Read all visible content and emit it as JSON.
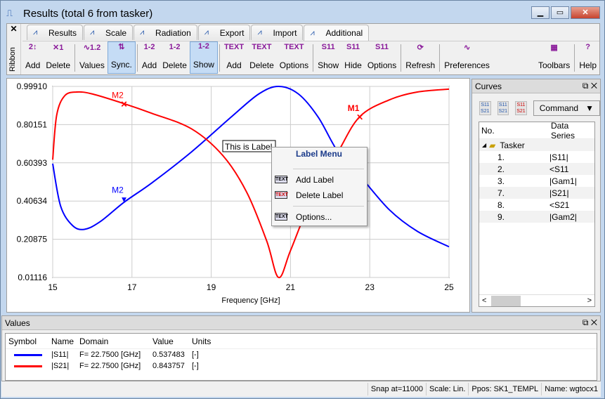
{
  "window": {
    "title": "Results (total 6 from tasker)",
    "icon": "chart-icon"
  },
  "ribbon": {
    "label": "Ribbon",
    "close": "✕",
    "tabs": [
      {
        "label": "Results",
        "icon": "results-icon"
      },
      {
        "label": "Scale",
        "icon": "scale-icon"
      },
      {
        "label": "Radiation",
        "icon": "radiation-icon"
      },
      {
        "label": "Export",
        "icon": "export-icon"
      },
      {
        "label": "Import",
        "icon": "import-icon"
      },
      {
        "label": "Additional",
        "icon": "additional-icon",
        "active": true
      }
    ],
    "tools": [
      {
        "label": "Add",
        "glyph": "2↕"
      },
      {
        "label": "Delete",
        "glyph": "✕1"
      },
      {
        "label": "Values",
        "glyph": "∿1.2"
      },
      {
        "label": "Sync.",
        "glyph": "⇅",
        "on": true
      },
      {
        "label": "Add",
        "glyph": "1-2"
      },
      {
        "label": "Delete",
        "glyph": "1-2"
      },
      {
        "label": "Show",
        "glyph": "1-2",
        "on": true
      },
      {
        "label": "Add",
        "glyph": "TEXT"
      },
      {
        "label": "Delete",
        "glyph": "TEXT"
      },
      {
        "label": "Options",
        "glyph": "TEXT"
      },
      {
        "label": "Show",
        "glyph": "S11"
      },
      {
        "label": "Hide",
        "glyph": "S11"
      },
      {
        "label": "Options",
        "glyph": "S11"
      },
      {
        "label": "Refresh",
        "glyph": "⟳"
      },
      {
        "label": "Preferences",
        "glyph": "∿"
      },
      {
        "label": "Toolbars",
        "glyph": "▦"
      },
      {
        "label": "Help",
        "glyph": "?"
      }
    ]
  },
  "chart_data": {
    "type": "line",
    "xlabel": "Frequency [GHz]",
    "ylabel": "",
    "xlim": [
      15,
      25
    ],
    "ylim": [
      0.01116,
      0.9991
    ],
    "xticks": [
      "15",
      "17",
      "19",
      "21",
      "23",
      "25"
    ],
    "yticks": [
      "0.99910",
      "0.80151",
      "0.60393",
      "0.40634",
      "0.20875",
      "0.01116"
    ],
    "grid": true,
    "series": [
      {
        "name": "|S11|",
        "color": "#0000ff",
        "x": [
          15,
          15.2,
          15.5,
          15.8,
          16.2,
          16.8,
          17.5,
          18.5,
          19.5,
          20.2,
          20.7,
          21.2,
          21.7,
          22.2,
          22.75,
          23.5,
          24.2,
          25
        ],
        "y": [
          0.6,
          0.38,
          0.28,
          0.26,
          0.3,
          0.4,
          0.5,
          0.66,
          0.84,
          0.96,
          0.999,
          0.96,
          0.84,
          0.66,
          0.537,
          0.36,
          0.25,
          0.17
        ]
      },
      {
        "name": "|S21|",
        "color": "#ff0000",
        "x": [
          15,
          15.1,
          15.3,
          15.6,
          16,
          16.8,
          17.5,
          18.5,
          19.3,
          19.9,
          20.4,
          20.7,
          21,
          21.5,
          22.2,
          22.75,
          23.5,
          24.2,
          25
        ],
        "y": [
          0.62,
          0.85,
          0.95,
          0.97,
          0.96,
          0.91,
          0.86,
          0.78,
          0.64,
          0.45,
          0.2,
          0.01116,
          0.15,
          0.4,
          0.66,
          0.843,
          0.93,
          0.97,
          0.985
        ]
      }
    ],
    "markers": [
      {
        "label": "M2",
        "series": "|S21|",
        "x": 16.8,
        "y": 0.91
      },
      {
        "label": "M2",
        "series": "|S11|",
        "x": 16.8,
        "y": 0.42
      },
      {
        "label": "M1",
        "series": "|S21|",
        "x": 22.75,
        "y": 0.843
      }
    ],
    "annotation": "This is Label"
  },
  "context_menu": {
    "title": "Label Menu",
    "items": [
      "Add Label",
      "Delete Label",
      "Options..."
    ]
  },
  "curves": {
    "title": "Curves",
    "command": "Command",
    "columns": [
      "No.",
      "Data Series"
    ],
    "group": "Tasker",
    "rows": [
      {
        "no": "1.",
        "name": "|S11|"
      },
      {
        "no": "2.",
        "name": "<S11"
      },
      {
        "no": "3.",
        "name": "|Gam1|"
      },
      {
        "no": "7.",
        "name": "|S21|"
      },
      {
        "no": "8.",
        "name": "<S21"
      },
      {
        "no": "9.",
        "name": "|Gam2|"
      }
    ]
  },
  "values": {
    "title": "Values",
    "columns": [
      "Symbol",
      "Name",
      "Domain",
      "Value",
      "Units"
    ],
    "rows": [
      {
        "color": "#0000ff",
        "name": "|S11|",
        "domain": "F= 22.7500 [GHz]",
        "value": "0.537483",
        "units": "[-]"
      },
      {
        "color": "#ff0000",
        "name": "|S21|",
        "domain": "F= 22.7500 [GHz]",
        "value": "0.843757",
        "units": "[-]"
      }
    ]
  },
  "status": [
    "Snap at=11000",
    "Scale: Lin.",
    "Ppos: SK1_TEMPL",
    "Name: wgtocx1"
  ]
}
